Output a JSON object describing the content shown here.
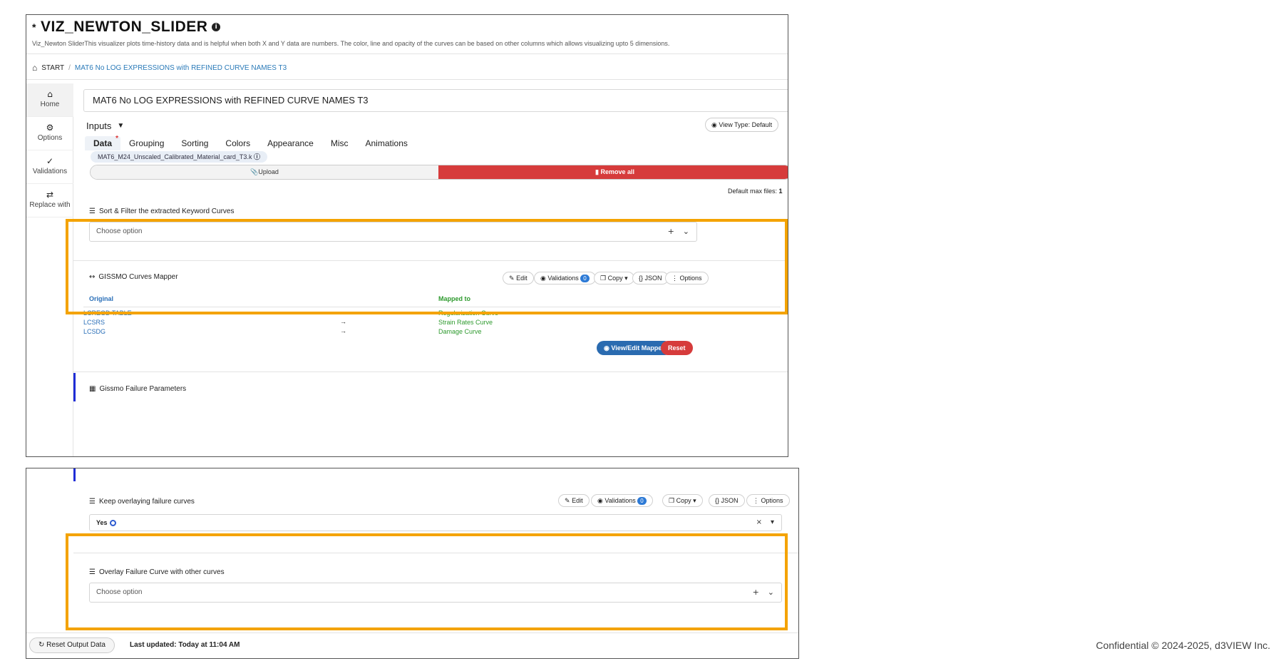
{
  "header": {
    "title": "VIZ_NEWTON_SLIDER",
    "subtitle": "Viz_Newton SliderThis visualizer plots time-history data and is helpful when both X and Y data are numbers. The color, line and opacity of the curves can be based on other columns which allows visualizing upto 5 dimensions."
  },
  "breadcrumb": {
    "start": "START",
    "current": "MAT6 No LOG EXPRESSIONS with REFINED CURVE NAMES T3"
  },
  "sidebar": {
    "items": [
      {
        "label": "Home",
        "icon": "home-icon"
      },
      {
        "label": "Options",
        "icon": "gear-icon"
      },
      {
        "label": "Validations",
        "icon": "check-icon"
      },
      {
        "label": "Replace with",
        "icon": "swap-icon"
      }
    ]
  },
  "main": {
    "name_value": "MAT6 No LOG EXPRESSIONS with REFINED CURVE NAMES T3",
    "inputs_label": "Inputs",
    "view_type": "View Type: Default",
    "tabs": [
      "Data",
      "Grouping",
      "Sorting",
      "Colors",
      "Appearance",
      "Misc",
      "Animations"
    ],
    "file_chip": "MAT6_M24_Unscaled_Calibrated_Material_card_T3.k",
    "upload_label": "Upload",
    "remove_all_label": "Remove all",
    "max_files_label": "Default max files:",
    "max_files_value": "1"
  },
  "sort_filter": {
    "label": "Sort & Filter the extracted Keyword Curves",
    "placeholder": "Choose option"
  },
  "mapper": {
    "label": "GISSMO Curves Mapper",
    "buttons": {
      "edit": "Edit",
      "validations": "Validations",
      "validations_count": "0",
      "copy": "Copy",
      "json": "JSON",
      "options": "Options"
    },
    "col_original": "Original",
    "col_mapped": "Mapped to",
    "rows": [
      {
        "original": "LCREGD TABLE",
        "arrow": "→",
        "mapped": "Regularization Curve"
      },
      {
        "original": "LCSRS",
        "arrow": "→",
        "mapped": "Strain Rates Curve"
      },
      {
        "original": "LCSDG",
        "arrow": "→",
        "mapped": "Damage Curve"
      }
    ],
    "view_edit_label": "View/Edit Mapper",
    "reset_label": "Reset"
  },
  "gissmo_params": {
    "label": "Gissmo Failure Parameters"
  },
  "keep_overlay": {
    "label": "Keep overlaying failure curves",
    "buttons": {
      "edit": "Edit",
      "validations": "Validations",
      "validations_count": "0",
      "copy": "Copy",
      "json": "JSON",
      "options": "Options"
    },
    "value": "Yes"
  },
  "overlay_failure": {
    "label": "Overlay Failure Curve with other curves",
    "placeholder": "Choose option"
  },
  "bottom_bar": {
    "reset_output": "Reset Output Data",
    "last_updated": "Last updated: Today at 11:04 AM"
  },
  "footer": {
    "text": "Confidential © 2024-2025, d3VIEW Inc."
  },
  "colors": {
    "highlight": "#f4a300",
    "danger": "#d63b3b",
    "primary": "#2a6bb0",
    "accent_bar": "#1f2dd6"
  }
}
